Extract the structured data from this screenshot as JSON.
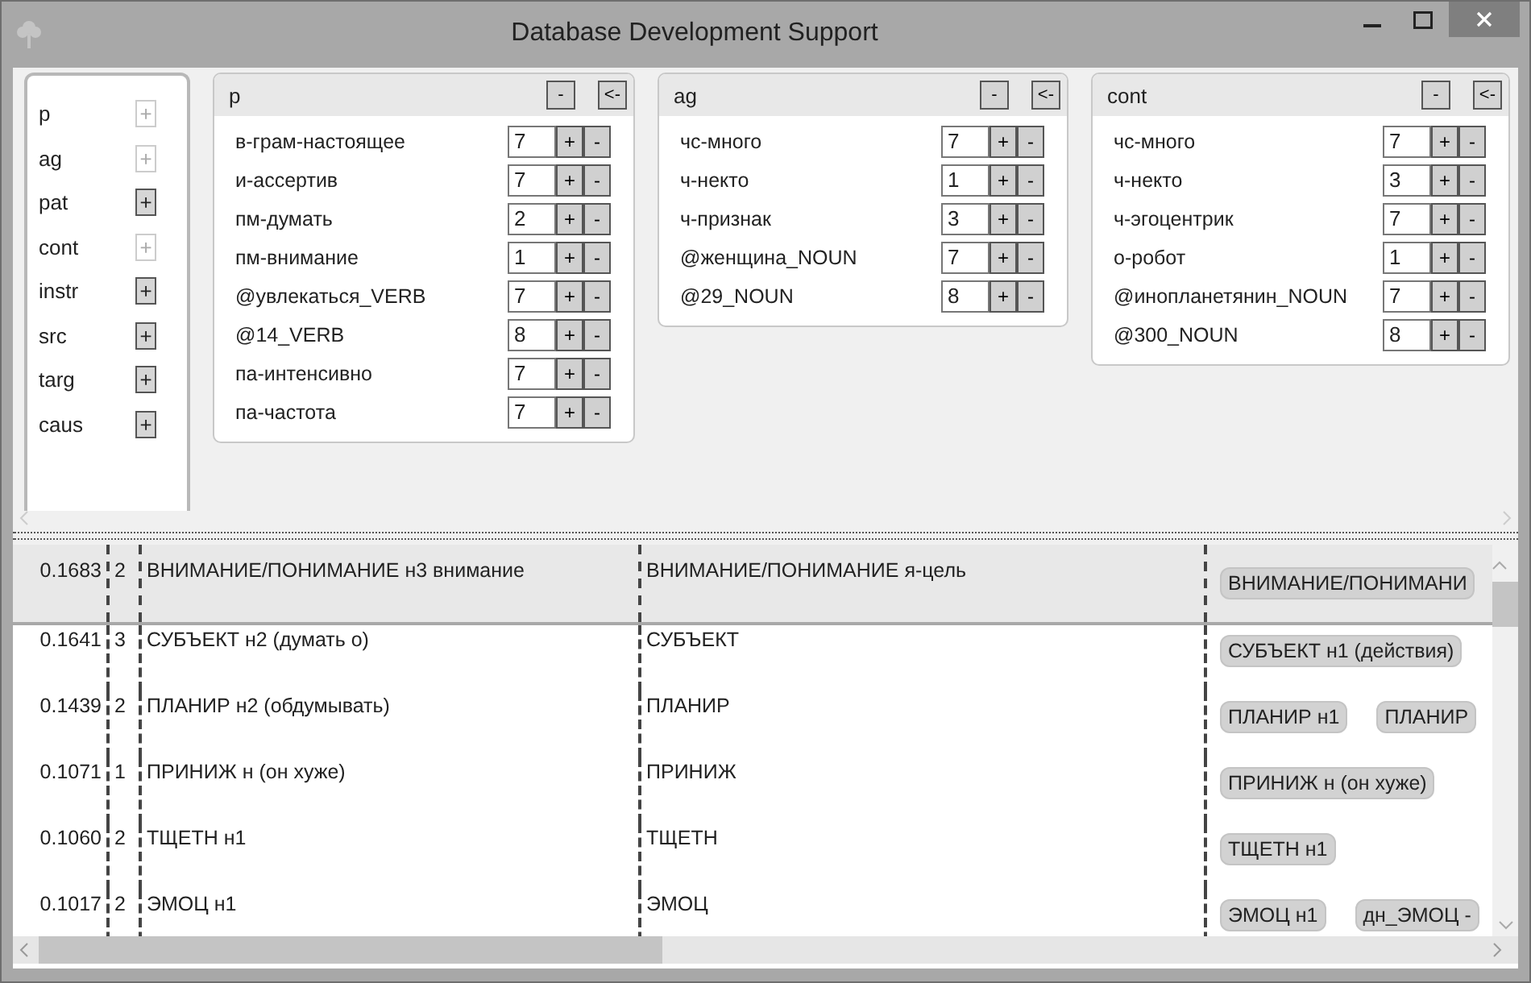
{
  "window": {
    "title": "Database Development Support"
  },
  "roles": [
    {
      "label": "p",
      "button": "+",
      "disabled": true
    },
    {
      "label": "ag",
      "button": "+",
      "disabled": true
    },
    {
      "label": "pat",
      "button": "+",
      "disabled": false
    },
    {
      "label": "cont",
      "button": "+",
      "disabled": true
    },
    {
      "label": "instr",
      "button": "+",
      "disabled": false
    },
    {
      "label": "src",
      "button": "+",
      "disabled": false
    },
    {
      "label": "targ",
      "button": "+",
      "disabled": false
    },
    {
      "label": "caus",
      "button": "+",
      "disabled": false
    }
  ],
  "panels": [
    {
      "title": "p",
      "remove_button": "-",
      "back_button": "<-",
      "rows": [
        {
          "label": "в-грам-настоящее",
          "value": "7",
          "plus": "+",
          "minus": "-"
        },
        {
          "label": "и-ассертив",
          "value": "7",
          "plus": "+",
          "minus": "-"
        },
        {
          "label": "пм-думать",
          "value": "2",
          "plus": "+",
          "minus": "-"
        },
        {
          "label": "пм-внимание",
          "value": "1",
          "plus": "+",
          "minus": "-"
        },
        {
          "label": "@увлекаться_VERB",
          "value": "7",
          "plus": "+",
          "minus": "-"
        },
        {
          "label": "@14_VERB",
          "value": "8",
          "plus": "+",
          "minus": "-"
        },
        {
          "label": "па-интенсивно",
          "value": "7",
          "plus": "+",
          "minus": "-"
        },
        {
          "label": "па-частота",
          "value": "7",
          "plus": "+",
          "minus": "-"
        }
      ]
    },
    {
      "title": "ag",
      "remove_button": "-",
      "back_button": "<-",
      "rows": [
        {
          "label": "чс-много",
          "value": "7",
          "plus": "+",
          "minus": "-"
        },
        {
          "label": "ч-некто",
          "value": "1",
          "plus": "+",
          "minus": "-"
        },
        {
          "label": "ч-признак",
          "value": "3",
          "plus": "+",
          "minus": "-"
        },
        {
          "label": "@женщина_NOUN",
          "value": "7",
          "plus": "+",
          "minus": "-"
        },
        {
          "label": "@29_NOUN",
          "value": "8",
          "plus": "+",
          "minus": "-"
        }
      ]
    },
    {
      "title": "cont",
      "remove_button": "-",
      "back_button": "<-",
      "rows": [
        {
          "label": "чс-много",
          "value": "7",
          "plus": "+",
          "minus": "-"
        },
        {
          "label": "ч-некто",
          "value": "3",
          "plus": "+",
          "minus": "-"
        },
        {
          "label": "ч-эгоцентрик",
          "value": "7",
          "plus": "+",
          "minus": "-"
        },
        {
          "label": "о-робот",
          "value": "1",
          "plus": "+",
          "minus": "-"
        },
        {
          "label": "@инопланетянин_NOUN",
          "value": "7",
          "plus": "+",
          "minus": "-"
        },
        {
          "label": "@300_NOUN",
          "value": "8",
          "plus": "+",
          "minus": "-"
        }
      ]
    }
  ],
  "table": {
    "rows": [
      {
        "column_1": "0.1683",
        "column_2": "2",
        "column_3": "ВНИМАНИЕ/ПОНИМАНИЕ н3 внимание",
        "column_4": "ВНИМАНИЕ/ПОНИМАНИЕ я-цель",
        "column_5": [
          "ВНИМАНИЕ/ПОНИМАНИ"
        ],
        "selected": true
      },
      {
        "column_1": "0.1641",
        "column_2": "3",
        "column_3": "СУБЪЕКТ н2 (думать о)",
        "column_4": "СУБЪЕКТ",
        "column_5": [
          "СУБЪЕКТ н1 (действия)"
        ],
        "selected": false
      },
      {
        "column_1": "0.1439",
        "column_2": "2",
        "column_3": "ПЛАНИР н2 (обдумывать)",
        "column_4": "ПЛАНИР",
        "column_5": [
          "ПЛАНИР н1",
          "ПЛАНИР"
        ],
        "selected": false
      },
      {
        "column_1": "0.1071",
        "column_2": "1",
        "column_3": "ПРИНИЖ н (он хуже)",
        "column_4": "ПРИНИЖ",
        "column_5": [
          "ПРИНИЖ н (он хуже)"
        ],
        "selected": false
      },
      {
        "column_1": "0.1060",
        "column_2": "2",
        "column_3": "ТЩЕТН н1",
        "column_4": "ТЩЕТН",
        "column_5": [
          "ТЩЕТН н1"
        ],
        "selected": false
      },
      {
        "column_1": "0.1017",
        "column_2": "2",
        "column_3": "ЭМОЦ н1",
        "column_4": "ЭМОЦ",
        "column_5": [
          "ЭМОЦ н1",
          "дн_ЭМОЦ -"
        ],
        "selected": false
      }
    ]
  }
}
